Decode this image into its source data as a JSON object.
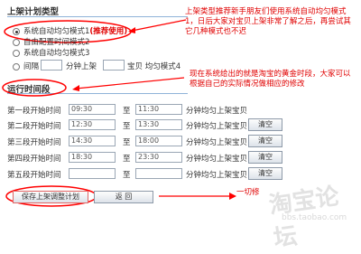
{
  "section1": {
    "title": "上架计划类型"
  },
  "options": [
    {
      "label": "系统自动均匀模式1",
      "tag": "(推荐使用)"
    },
    {
      "label": "自由配置时间模式2"
    },
    {
      "label": "系统自动均匀模式3"
    },
    {
      "label_prefix": "间隔",
      "label_mid": "分钟上架",
      "label_suffix": "宝贝  均匀模式4",
      "minutes_value": "",
      "count_value": ""
    }
  ],
  "annotation1": "上架类型推荐新手朋友们使用系统自动均匀模式1，日后大家对宝贝上架非常了解之后，再尝试其它几种模式也不迟",
  "annotation2": "现在系统给出的就是淘宝的黄金时段，大家可以根据自己的实际情况做相应的修改",
  "section2": {
    "title": "运行时间段"
  },
  "time_rows": [
    {
      "label": "第一段开始时间",
      "start": "09:30",
      "to": "至",
      "end": "11:30",
      "suffix": "分钟均匀上架宝贝",
      "clear": ""
    },
    {
      "label": "第二段开始时间",
      "start": "12:30",
      "to": "至",
      "end": "13:30",
      "suffix": "分钟均匀上架宝贝",
      "clear": "清空"
    },
    {
      "label": "第三段开始时间",
      "start": "14:30",
      "to": "至",
      "end": "18:00",
      "suffix": "分钟均匀上架宝贝",
      "clear": "清空"
    },
    {
      "label": "第四段开始时间",
      "start": "18:30",
      "to": "至",
      "end": "23:30",
      "suffix": "分钟均匀上架宝贝",
      "clear": "清空"
    },
    {
      "label": "第五段开始时间",
      "start": "",
      "to": "至",
      "end": "",
      "suffix": "分钟均匀上架宝贝",
      "clear": "清空"
    }
  ],
  "footer": {
    "save": "保存上架调整计划",
    "back": "返  回",
    "note": "一切修"
  },
  "watermark": {
    "main": "淘宝论坛",
    "url": "bbs.taobao.com"
  },
  "colors": {
    "highlight": "#ff0000",
    "annotation": "#e00000",
    "header_line": "#8fb3d9"
  }
}
